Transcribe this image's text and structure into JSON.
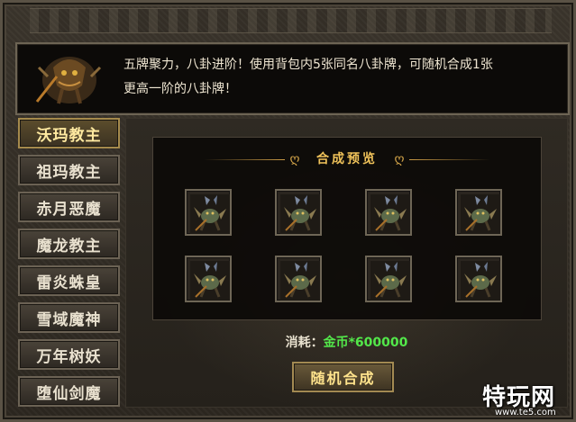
{
  "panel": {
    "description_line1": "五牌聚力，八卦进阶！使用背包内5张同名八卦牌，可随机合成1张",
    "description_line2": "更高一阶的八卦牌！"
  },
  "bosses": [
    {
      "label": "沃玛教主",
      "active": true
    },
    {
      "label": "祖玛教主",
      "active": false
    },
    {
      "label": "赤月恶魔",
      "active": false
    },
    {
      "label": "魔龙教主",
      "active": false
    },
    {
      "label": "雷炎蛛皇",
      "active": false
    },
    {
      "label": "雪域魔神",
      "active": false
    },
    {
      "label": "万年树妖",
      "active": false
    },
    {
      "label": "堕仙剑魔",
      "active": false
    }
  ],
  "preview": {
    "title": "合成预览",
    "slot_count": 8,
    "slot_icon": "winged-beast-card-icon"
  },
  "cost": {
    "label": "消耗：",
    "value": "金币*600000"
  },
  "merge_button": "随机合成",
  "watermark": {
    "main": "特玩网",
    "sub": "www.te5.com"
  },
  "colors": {
    "accent_gold": "#f0c35a",
    "cost_green": "#53e84a",
    "active_tab_text": "#ffe9a0"
  }
}
